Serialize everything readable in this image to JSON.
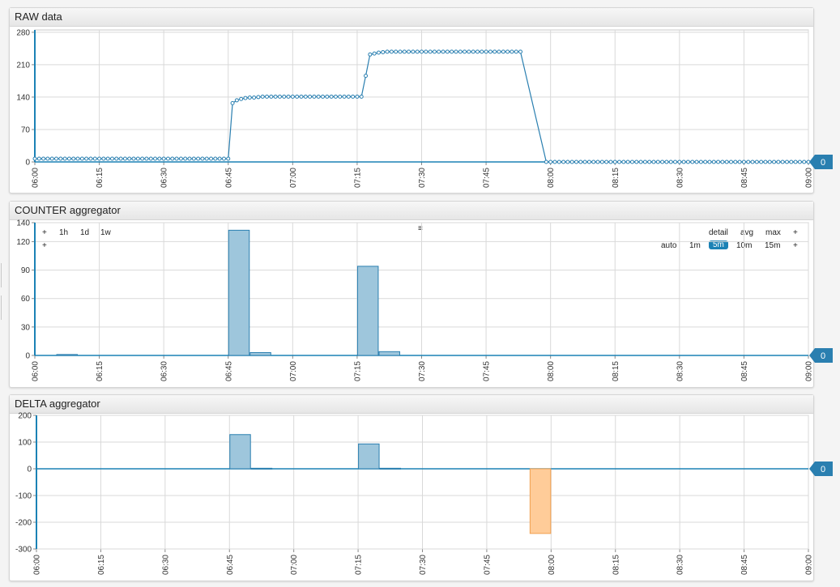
{
  "panels": [
    {
      "title": "RAW data"
    },
    {
      "title": "COUNTER aggregator"
    },
    {
      "title": "DELTA aggregator"
    }
  ],
  "controls": {
    "left_plus": "+",
    "left_plus2": "+",
    "periods": [
      "1h",
      "1d",
      "1w"
    ],
    "center_glyph": "≡",
    "modes": [
      "detail",
      "avg",
      "max",
      "+"
    ],
    "intervals": [
      "auto",
      "1m",
      "5m",
      "10m",
      "15m",
      "+"
    ],
    "active_interval": "5m"
  },
  "colors": {
    "series": "#2a7fb0",
    "bar_fill": "#9ec6dc",
    "bar_stroke": "#2a7fb0",
    "negative_fill": "#ffcc99",
    "negative_stroke": "#f0a050",
    "axis": "#1b82b5",
    "badge": "#2a7fb0"
  },
  "chart_data": [
    {
      "type": "line",
      "title": "RAW data",
      "x_ticks": [
        "06:00",
        "06:15",
        "06:30",
        "06:45",
        "07:00",
        "07:15",
        "07:30",
        "07:45",
        "08:00",
        "08:15",
        "08:30",
        "08:45",
        "09:00"
      ],
      "y_ticks": [
        0,
        70,
        140,
        210,
        280
      ],
      "ylim": [
        0,
        285
      ],
      "xlim_minutes": [
        0,
        180
      ],
      "grid": true,
      "markers": true,
      "last_value_badge": "0",
      "segments": [
        {
          "from": 0,
          "to": 45,
          "step": 1,
          "value": 7
        },
        {
          "points": [
            [
              46,
              127
            ],
            [
              47,
              133
            ],
            [
              48,
              136
            ],
            [
              49,
              138
            ],
            [
              50,
              139
            ],
            [
              51,
              139
            ],
            [
              52,
              140
            ]
          ]
        },
        {
          "from": 53,
          "to": 76,
          "step": 1,
          "value": 141
        },
        {
          "points": [
            [
              77,
              186
            ],
            [
              78,
              232
            ],
            [
              79,
              234
            ],
            [
              80,
              236
            ],
            [
              81,
              237
            ]
          ]
        },
        {
          "from": 82,
          "to": 113,
          "step": 1,
          "value": 238
        },
        {
          "from": 119,
          "to": 180,
          "step": 1,
          "value": 0
        }
      ]
    },
    {
      "type": "bar",
      "title": "COUNTER aggregator",
      "x_ticks": [
        "06:00",
        "06:15",
        "06:30",
        "06:45",
        "07:00",
        "07:15",
        "07:30",
        "07:45",
        "08:00",
        "08:15",
        "08:30",
        "08:45",
        "09:00"
      ],
      "y_ticks": [
        0,
        30,
        60,
        90,
        120,
        140
      ],
      "ylim": [
        0,
        140
      ],
      "xlim_minutes": [
        0,
        180
      ],
      "grid": true,
      "last_value_badge": "0",
      "bars": [
        {
          "start": 5,
          "end": 10,
          "value": 1
        },
        {
          "start": 45,
          "end": 50,
          "value": 132
        },
        {
          "start": 50,
          "end": 55,
          "value": 3
        },
        {
          "start": 75,
          "end": 80,
          "value": 94
        },
        {
          "start": 80,
          "end": 85,
          "value": 4
        }
      ]
    },
    {
      "type": "bar",
      "title": "DELTA aggregator",
      "x_ticks": [
        "06:00",
        "06:15",
        "06:30",
        "06:45",
        "07:00",
        "07:15",
        "07:30",
        "07:45",
        "08:00",
        "08:15",
        "08:30",
        "08:45",
        "09:00"
      ],
      "y_ticks": [
        -300,
        -200,
        -100,
        0,
        100,
        200
      ],
      "ylim": [
        -300,
        200
      ],
      "xlim_minutes": [
        0,
        180
      ],
      "grid": true,
      "last_value_badge": "0",
      "bars": [
        {
          "start": 45,
          "end": 50,
          "value": 128
        },
        {
          "start": 50,
          "end": 55,
          "value": 2
        },
        {
          "start": 75,
          "end": 80,
          "value": 93
        },
        {
          "start": 80,
          "end": 85,
          "value": 2
        },
        {
          "start": 115,
          "end": 120,
          "value": -242
        }
      ]
    }
  ]
}
